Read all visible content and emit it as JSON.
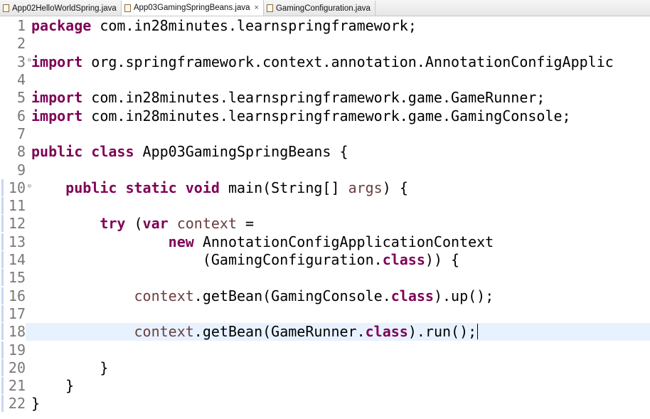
{
  "tabs": [
    {
      "label": "App02HelloWorldSpring.java",
      "active": false,
      "closable": false
    },
    {
      "label": "App03GamingSpringBeans.java",
      "active": true,
      "closable": true
    },
    {
      "label": "GamingConfiguration.java",
      "active": false,
      "closable": false
    }
  ],
  "editor": {
    "current_line": 18,
    "lines": [
      {
        "n": "1",
        "tokens": [
          [
            "kw",
            "package"
          ],
          [
            "plain",
            " com.in28minutes.learnspringframework;"
          ]
        ]
      },
      {
        "n": "2",
        "tokens": []
      },
      {
        "n": "3",
        "fold": true,
        "tokens": [
          [
            "kw",
            "import"
          ],
          [
            "plain",
            " org.springframework.context.annotation.AnnotationConfigApplic"
          ]
        ]
      },
      {
        "n": "4",
        "tokens": []
      },
      {
        "n": "5",
        "tokens": [
          [
            "kw",
            "import"
          ],
          [
            "plain",
            " com.in28minutes.learnspringframework.game.GameRunner;"
          ]
        ]
      },
      {
        "n": "6",
        "tokens": [
          [
            "kw",
            "import"
          ],
          [
            "plain",
            " com.in28minutes.learnspringframework.game.GamingConsole;"
          ]
        ]
      },
      {
        "n": "7",
        "tokens": []
      },
      {
        "n": "8",
        "tokens": [
          [
            "kw",
            "public"
          ],
          [
            "plain",
            " "
          ],
          [
            "kw",
            "class"
          ],
          [
            "plain",
            " App03GamingSpringBeans {"
          ]
        ]
      },
      {
        "n": "9",
        "tokens": []
      },
      {
        "n": "10",
        "fold": true,
        "tokens": [
          [
            "plain",
            "    "
          ],
          [
            "kw",
            "public"
          ],
          [
            "plain",
            " "
          ],
          [
            "kw",
            "static"
          ],
          [
            "plain",
            " "
          ],
          [
            "kw",
            "void"
          ],
          [
            "plain",
            " main(String[] "
          ],
          [
            "var",
            "args"
          ],
          [
            "plain",
            ") {"
          ]
        ]
      },
      {
        "n": "11",
        "tokens": []
      },
      {
        "n": "12",
        "tokens": [
          [
            "plain",
            "        "
          ],
          [
            "kw",
            "try"
          ],
          [
            "plain",
            " ("
          ],
          [
            "kw",
            "var"
          ],
          [
            "plain",
            " "
          ],
          [
            "var",
            "context"
          ],
          [
            "plain",
            " ="
          ]
        ]
      },
      {
        "n": "13",
        "tokens": [
          [
            "plain",
            "                "
          ],
          [
            "kw",
            "new"
          ],
          [
            "plain",
            " AnnotationConfigApplicationContext"
          ]
        ]
      },
      {
        "n": "14",
        "tokens": [
          [
            "plain",
            "                    (GamingConfiguration."
          ],
          [
            "kw",
            "class"
          ],
          [
            "plain",
            ")) {"
          ]
        ]
      },
      {
        "n": "15",
        "tokens": []
      },
      {
        "n": "16",
        "tokens": [
          [
            "plain",
            "            "
          ],
          [
            "var",
            "context"
          ],
          [
            "plain",
            ".getBean(GamingConsole."
          ],
          [
            "kw",
            "class"
          ],
          [
            "plain",
            ").up();"
          ]
        ]
      },
      {
        "n": "17",
        "tokens": []
      },
      {
        "n": "18",
        "tokens": [
          [
            "plain",
            "            "
          ],
          [
            "var",
            "context"
          ],
          [
            "plain",
            ".getBean(GameRunner."
          ],
          [
            "kw",
            "class"
          ],
          [
            "plain",
            ").run();"
          ]
        ]
      },
      {
        "n": "19",
        "tokens": []
      },
      {
        "n": "20",
        "tokens": [
          [
            "plain",
            "        }"
          ]
        ]
      },
      {
        "n": "21",
        "tokens": [
          [
            "plain",
            "    }"
          ]
        ]
      },
      {
        "n": "22",
        "tokens": [
          [
            "plain",
            "}"
          ]
        ]
      }
    ]
  }
}
